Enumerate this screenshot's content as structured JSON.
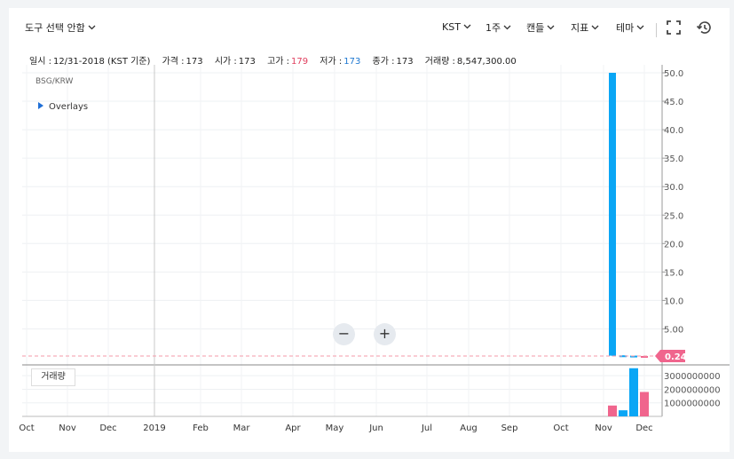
{
  "toolbar": {
    "tool_select_label": "도구 선택 안함",
    "timezone_label": "KST",
    "period_label": "1주",
    "chart_type_label": "캔들",
    "indicator_label": "지표",
    "theme_label": "테마",
    "fullscreen_icon": "fullscreen-icon",
    "reset_icon": "history-reset-icon"
  },
  "info": {
    "date_key": "일시 :",
    "date_value": "12/31-2018 (KST 기준)",
    "price_key": "가격 :",
    "price_value": "173",
    "open_key": "시가 :",
    "open_value": "173",
    "high_key": "고가 :",
    "high_value": "179",
    "low_key": "저가 :",
    "low_value": "173",
    "close_key": "종가 :",
    "close_value": "173",
    "volume_key": "거래량 :",
    "volume_value": "8,547,300.00"
  },
  "chart": {
    "symbol": "BSG/KRW",
    "overlays_label": "Overlays",
    "current_price_tag": "0.24",
    "volume_button": "거래량",
    "zoom_out": "−",
    "zoom_in": "+"
  },
  "colors": {
    "up": "#f0658d",
    "down": "#0aa6f5",
    "high_text": "#e0405f",
    "low_text": "#1f78d1",
    "price_line": "#f59aaa"
  },
  "chart_data": [
    {
      "type": "candlestick",
      "title": "BSG/KRW",
      "y_ticks": [
        "5.00",
        "10.0",
        "15.0",
        "20.0",
        "25.0",
        "30.0",
        "35.0",
        "40.0",
        "45.0",
        "50.0"
      ],
      "ylim": [
        0,
        50
      ],
      "x_ticks": [
        "Oct",
        "Nov",
        "Dec",
        "2019",
        "Feb",
        "Mar",
        "Apr",
        "May",
        "Jun",
        "Jul",
        "Aug",
        "Sep",
        "Oct",
        "Nov",
        "Dec"
      ],
      "candles": [
        {
          "x": "Nov (week 1)",
          "open": 50.0,
          "close": 0.3,
          "high": 50.0,
          "low": 0.2,
          "direction": "down"
        },
        {
          "x": "Nov (week 2)",
          "open": 0.35,
          "close": 0.3,
          "high": 0.35,
          "low": 0.3,
          "direction": "down"
        },
        {
          "x": "Dec (week 1)",
          "open": 0.3,
          "close": 0.25,
          "high": 0.3,
          "low": 0.25,
          "direction": "down"
        },
        {
          "x": "Dec (week 2)",
          "open": 0.22,
          "close": 0.24,
          "high": 0.24,
          "low": 0.2,
          "direction": "up"
        }
      ],
      "last_price": 0.24,
      "grid": true
    },
    {
      "type": "bar",
      "title": "거래량",
      "y_ticks": [
        "1000000000",
        "2000000000",
        "3000000000"
      ],
      "ylim": [
        0,
        3600000000
      ],
      "bars": [
        {
          "x": "Nov (week 1)",
          "value": 800000000,
          "direction": "up"
        },
        {
          "x": "Nov (week 2)",
          "value": 450000000,
          "direction": "down"
        },
        {
          "x": "Dec (week 1)",
          "value": 3550000000,
          "direction": "down"
        },
        {
          "x": "Dec (week 2)",
          "value": 1800000000,
          "direction": "up"
        }
      ]
    }
  ]
}
